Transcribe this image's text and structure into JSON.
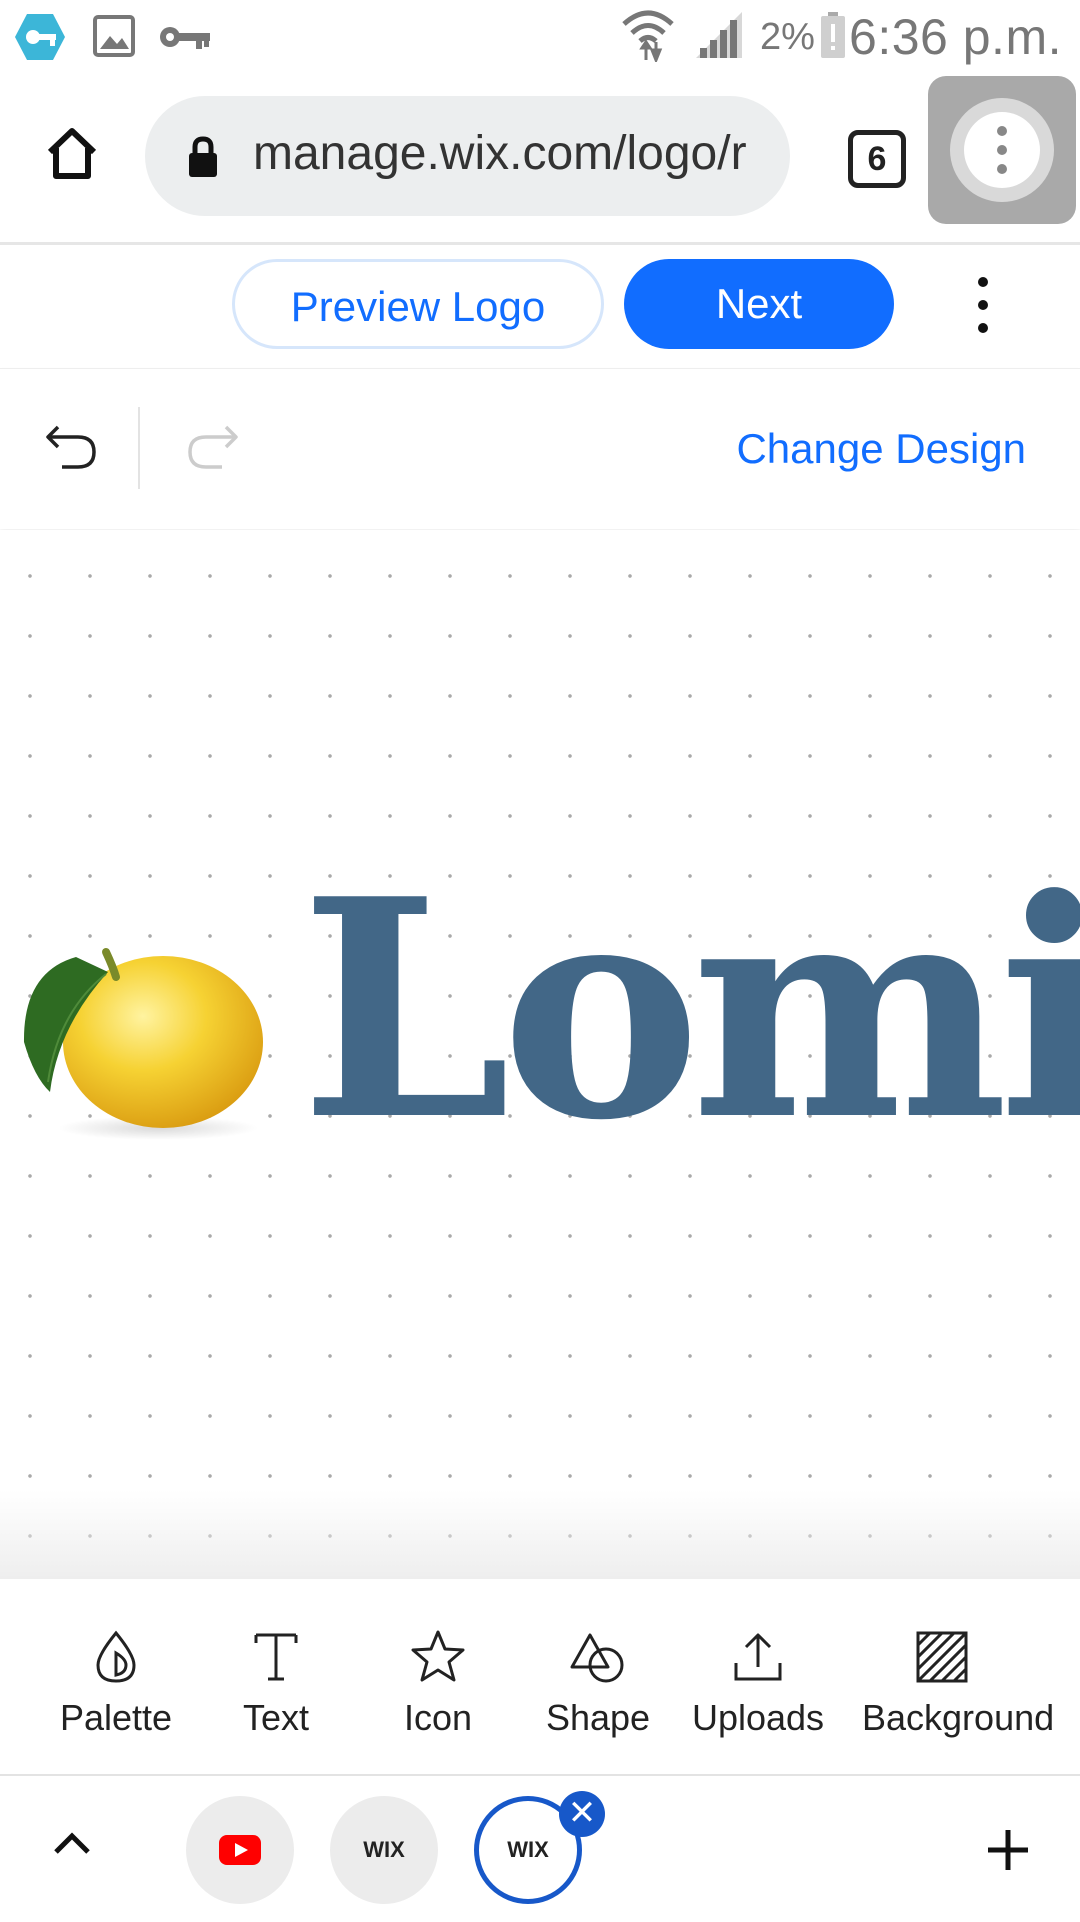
{
  "status_bar": {
    "battery_percent": "2%",
    "time": "6:36 p.m.",
    "icons": [
      "vpn-key-icon",
      "image-icon",
      "key-icon",
      "wifi-icon",
      "signal-icon",
      "battery-alert-icon"
    ]
  },
  "browser": {
    "url": "manage.wix.com/logo/r",
    "tab_count": "6"
  },
  "toolbar": {
    "preview_label": "Preview Logo",
    "next_label": "Next",
    "change_design_label": "Change Design"
  },
  "logo": {
    "text": "Lomi",
    "text_color": "#426787",
    "image": "lemon-with-leaf"
  },
  "tools": [
    {
      "label": "Palette",
      "icon": "palette-drop-icon"
    },
    {
      "label": "Text",
      "icon": "text-icon"
    },
    {
      "label": "Icon",
      "icon": "star-icon"
    },
    {
      "label": "Shape",
      "icon": "shape-icon"
    },
    {
      "label": "Uploads",
      "icon": "upload-icon"
    },
    {
      "label": "Background",
      "icon": "background-hatch-icon"
    }
  ],
  "tabbar": {
    "tabs": [
      {
        "label": "",
        "icon": "youtube-icon"
      },
      {
        "label": "WIX",
        "icon": "wix-icon"
      },
      {
        "label": "WIX",
        "icon": "wix-icon",
        "active": true
      }
    ]
  },
  "colors": {
    "accent": "#116dff",
    "tab_active": "#1758c9"
  }
}
